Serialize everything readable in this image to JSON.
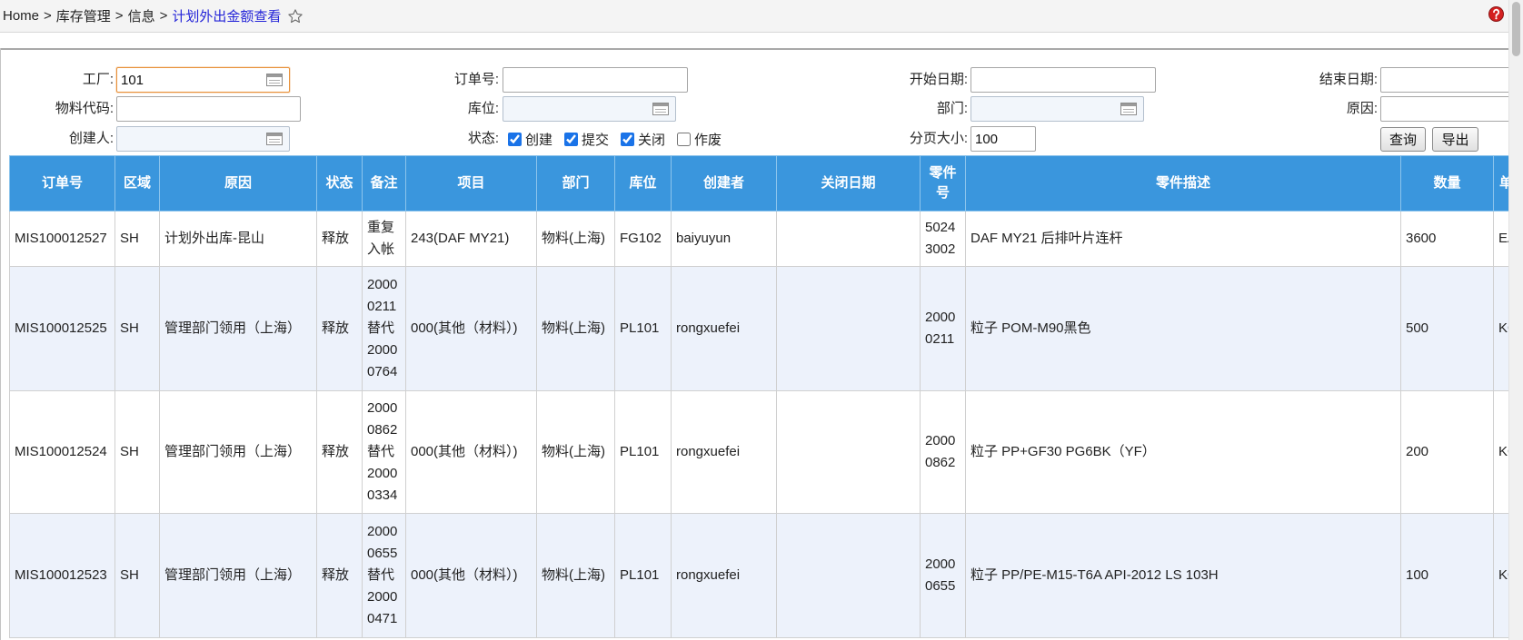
{
  "breadcrumb": {
    "items": [
      "Home",
      "库存管理",
      "信息"
    ],
    "separator": ">",
    "current": "计划外出金额查看"
  },
  "icons": {
    "favorite": "star-outline-icon",
    "help": "help-icon",
    "lookup": "lookup-icon"
  },
  "colors": {
    "table_header_bg": "#3a96dd",
    "table_header_text": "#ffffff",
    "row_alt_bg": "#edf2fb",
    "breadcrumb_current": "#2424d8",
    "focused_input_border": "#e8913a",
    "help_icon": "#d42020",
    "checkbox_checked": "#1a73e8"
  },
  "filters": {
    "plant": {
      "label": "工厂:",
      "value": "101"
    },
    "order_no": {
      "label": "订单号:",
      "value": ""
    },
    "start_date": {
      "label": "开始日期:",
      "value": ""
    },
    "end_date": {
      "label": "结束日期:",
      "value": ""
    },
    "material_code": {
      "label": "物料代码:",
      "value": ""
    },
    "location": {
      "label": "库位:",
      "value": ""
    },
    "department": {
      "label": "部门:",
      "value": ""
    },
    "reason": {
      "label": "原因:",
      "value": ""
    },
    "creator": {
      "label": "创建人:",
      "value": ""
    },
    "status": {
      "label": "状态:",
      "options": [
        {
          "label": "创建",
          "checked": true
        },
        {
          "label": "提交",
          "checked": true
        },
        {
          "label": "关闭",
          "checked": true
        },
        {
          "label": "作废",
          "checked": false
        }
      ]
    },
    "page_size": {
      "label": "分页大小:",
      "value": "100"
    }
  },
  "buttons": {
    "query": "查询",
    "export": "导出"
  },
  "table": {
    "columns": [
      "订单号",
      "区域",
      "原因",
      "状态",
      "备注",
      "项目",
      "部门",
      "库位",
      "创建者",
      "关闭日期",
      "零件号",
      "零件描述",
      "数量",
      "单"
    ],
    "rows": [
      [
        "MIS100012527",
        "SH",
        "计划外出库-昆山",
        "释放",
        "重复入帐",
        "243(DAF MY21)",
        "物料(上海)",
        "FG102",
        "baiyuyun",
        "",
        "50243002",
        "DAF MY21 后排叶片连杆",
        "3600",
        "EA"
      ],
      [
        "MIS100012525",
        "SH",
        "管理部门领用（上海）",
        "释放",
        "20000211替代20000764",
        "000(其他（材料）)",
        "物料(上海)",
        "PL101",
        "rongxuefei",
        "",
        "20000211",
        "粒子 POM-M90黑色",
        "500",
        "KG"
      ],
      [
        "MIS100012524",
        "SH",
        "管理部门领用（上海）",
        "释放",
        "20000862替代20000334",
        "000(其他（材料）)",
        "物料(上海)",
        "PL101",
        "rongxuefei",
        "",
        "20000862",
        "粒子 PP+GF30 PG6BK（YF）",
        "200",
        "KG"
      ],
      [
        "MIS100012523",
        "SH",
        "管理部门领用（上海）",
        "释放",
        "20000655替代20000471",
        "000(其他（材料）)",
        "物料(上海)",
        "PL101",
        "rongxuefei",
        "",
        "20000655",
        "粒子 PP/PE-M15-T6A API-2012 LS 103H",
        "100",
        "KG"
      ]
    ]
  }
}
